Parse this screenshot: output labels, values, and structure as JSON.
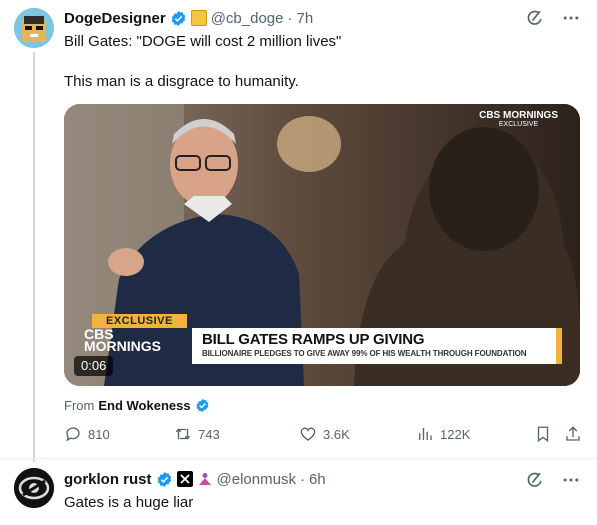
{
  "post1": {
    "author": {
      "display_name": "DogeDesigner",
      "handle": "@cb_doge",
      "separator": "·",
      "time": "7h"
    },
    "text_line1": "Bill Gates: \"DOGE will cost 2 million lives\"",
    "text_line2": "This man is a disgrace to humanity.",
    "media": {
      "corner_logo": "CBS MORNINGS",
      "corner_exclusive": "EXCLUSIVE",
      "exclusive_tag": "EXCLUSIVE",
      "lower_third_logo_top": "CBS",
      "lower_third_logo_bottom": "MORNINGS",
      "headline": "BILL GATES RAMPS UP GIVING",
      "subheadline": "BILLIONAIRE PLEDGES TO GIVE AWAY 99% OF HIS WEALTH THROUGH FOUNDATION",
      "timer": "0:06"
    },
    "from": {
      "label": "From",
      "name": "End Wokeness"
    },
    "actions": {
      "replies": "810",
      "reposts": "743",
      "likes": "3.6K",
      "views": "122K"
    }
  },
  "post2": {
    "author": {
      "display_name": "gorklon rust",
      "handle": "@elonmusk",
      "separator": "·",
      "time": "6h"
    },
    "text_line1": "Gates is a huge liar"
  },
  "colors": {
    "verified_blue": "#1d9bf0",
    "muted_text": "#536471",
    "banner_accent": "#f0b43c"
  },
  "icons": [
    "grok-icon",
    "more-icon",
    "verified-badge-icon",
    "reply-icon",
    "repost-icon",
    "like-icon",
    "views-icon",
    "bookmark-icon",
    "share-icon",
    "x-logo-icon"
  ]
}
